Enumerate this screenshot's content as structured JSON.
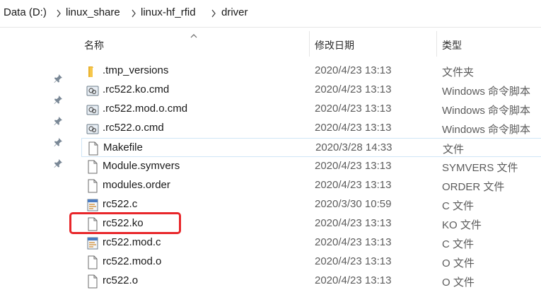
{
  "breadcrumb": [
    "Data (D:)",
    "linux_share",
    "linux-hf_rfid",
    "driver"
  ],
  "columns": {
    "name": "名称",
    "date": "修改日期",
    "type": "类型"
  },
  "files": [
    {
      "name": ".tmp_versions",
      "date": "2020/4/23 13:13",
      "type": "文件夹",
      "icon": "folder-icon"
    },
    {
      "name": ".rc522.ko.cmd",
      "date": "2020/4/23 13:13",
      "type": "Windows 命令脚本",
      "icon": "cmd-script-icon"
    },
    {
      "name": ".rc522.mod.o.cmd",
      "date": "2020/4/23 13:13",
      "type": "Windows 命令脚本",
      "icon": "cmd-script-icon"
    },
    {
      "name": ".rc522.o.cmd",
      "date": "2020/4/23 13:13",
      "type": "Windows 命令脚本",
      "icon": "cmd-script-icon"
    },
    {
      "name": "Makefile",
      "date": "2020/3/28 14:33",
      "type": "文件",
      "icon": "file-icon"
    },
    {
      "name": "Module.symvers",
      "date": "2020/4/23 13:13",
      "type": "SYMVERS 文件",
      "icon": "file-icon"
    },
    {
      "name": "modules.order",
      "date": "2020/4/23 13:13",
      "type": "ORDER 文件",
      "icon": "file-icon"
    },
    {
      "name": "rc522.c",
      "date": "2020/3/30 10:59",
      "type": "C 文件",
      "icon": "c-source-icon"
    },
    {
      "name": "rc522.ko",
      "date": "2020/4/23 13:13",
      "type": "KO 文件",
      "icon": "file-icon"
    },
    {
      "name": "rc522.mod.c",
      "date": "2020/4/23 13:13",
      "type": "C 文件",
      "icon": "c-source-icon"
    },
    {
      "name": "rc522.mod.o",
      "date": "2020/4/23 13:13",
      "type": "O 文件",
      "icon": "file-icon"
    },
    {
      "name": "rc522.o",
      "date": "2020/4/23 13:13",
      "type": "O 文件",
      "icon": "file-icon"
    }
  ],
  "highlight_color": "#e8262a"
}
